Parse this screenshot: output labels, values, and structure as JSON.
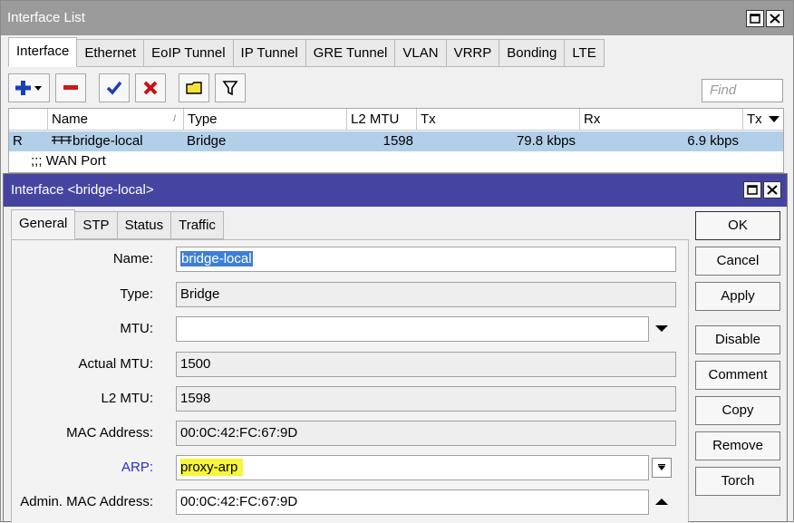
{
  "list_window": {
    "title": "Interface List",
    "tabs": [
      "Interface",
      "Ethernet",
      "EoIP Tunnel",
      "IP Tunnel",
      "GRE Tunnel",
      "VLAN",
      "VRRP",
      "Bonding",
      "LTE"
    ],
    "find_placeholder": "Find",
    "columns": {
      "name": "Name",
      "sort": "/",
      "type": "Type",
      "l2mtu": "L2 MTU",
      "tx": "Tx",
      "rx": "Rx",
      "tx2": "Tx"
    },
    "rows": [
      {
        "flag": "R",
        "name": "bridge-local",
        "type": "Bridge",
        "l2mtu": "1598",
        "tx": "79.8 kbps",
        "rx": "6.9 kbps"
      }
    ],
    "comment_row": ";;; WAN Port"
  },
  "dialog": {
    "title": "Interface <bridge-local>",
    "tabs": [
      "General",
      "STP",
      "Status",
      "Traffic"
    ],
    "fields": {
      "name": {
        "label": "Name:",
        "value": "bridge-local"
      },
      "type": {
        "label": "Type:",
        "value": "Bridge"
      },
      "mtu": {
        "label": "MTU:",
        "value": ""
      },
      "actual_mtu": {
        "label": "Actual MTU:",
        "value": "1500"
      },
      "l2mtu": {
        "label": "L2 MTU:",
        "value": "1598"
      },
      "mac": {
        "label": "MAC Address:",
        "value": "00:0C:42:FC:67:9D"
      },
      "arp": {
        "label": "ARP:",
        "value": "proxy-arp"
      },
      "admin_mac": {
        "label": "Admin. MAC Address:",
        "value": "00:0C:42:FC:67:9D"
      }
    },
    "buttons": [
      "OK",
      "Cancel",
      "Apply",
      "Disable",
      "Comment",
      "Copy",
      "Remove",
      "Torch"
    ]
  },
  "colors": {
    "dialog_titlebar": "#4545a1",
    "list_titlebar": "#9b9b9b",
    "selected_row": "#b2cfea",
    "highlight": "#f6f63a",
    "arp_label": "#2a2ad0"
  }
}
